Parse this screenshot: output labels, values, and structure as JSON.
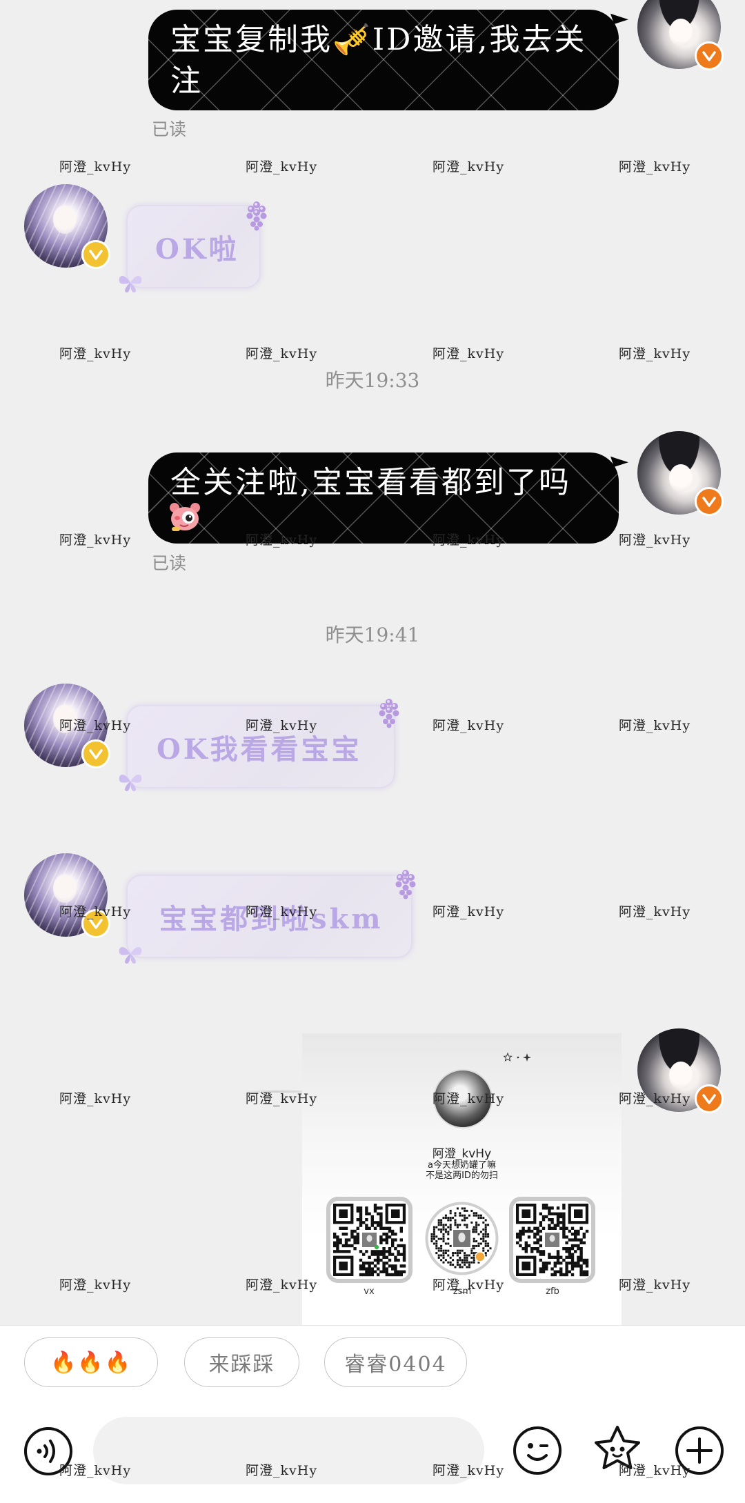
{
  "watermark": "阿澄_kvHy",
  "colors": {
    "chat_background": "#efeff0",
    "outgoing_bubble": "#050505",
    "incoming_bubble_text": "#b9a8e5",
    "badge_incoming": "#f3c230",
    "badge_outgoing": "#ef7a1b",
    "timestamp_text": "#8f8f8f"
  },
  "chat": {
    "messages": [
      {
        "from_me": true,
        "text": "宝宝复制我🎺ID邀请,我去关注",
        "read_status": "已读"
      },
      {
        "from_me": false,
        "text": "OK啦"
      },
      {
        "from_me": true,
        "text": "全关注啦,宝宝看看都到了吗",
        "sticker_icon": "bear-face-sticker-icon",
        "read_status": "已读"
      },
      {
        "from_me": false,
        "text": "OK我看看宝宝"
      },
      {
        "from_me": false,
        "text": "宝宝都到啦skm"
      }
    ],
    "timestamps": [
      "昨天19:33",
      "昨天19:41"
    ],
    "image_card": {
      "name": "阿澄_kvHy",
      "line1": "a今天想奶罐了嘛",
      "line2": "不是这两ID的勿扫",
      "qr_codes": [
        {
          "label": "vx"
        },
        {
          "label": "zsm"
        },
        {
          "label": "zfb"
        }
      ]
    }
  },
  "quick_replies": [
    "🔥🔥🔥",
    "来踩踩",
    "睿睿0404"
  ],
  "icons": {
    "voice": "voice-input-icon",
    "emoji": "emoji-icon",
    "sticker": "sticker-icon",
    "plus": "plus-icon",
    "badge": "verified-badge-icon",
    "flower": "flower-decoration-icon",
    "butterfly": "butterfly-decoration-icon"
  }
}
